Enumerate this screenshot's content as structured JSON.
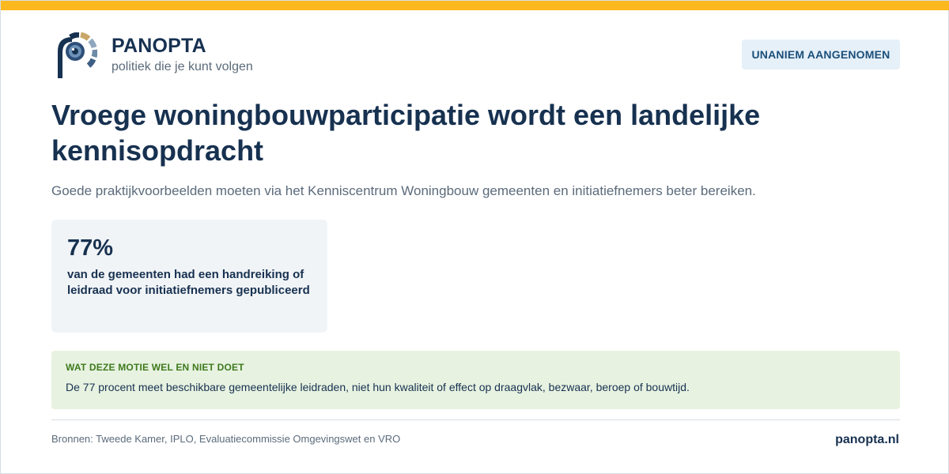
{
  "brand": {
    "name": "PANOPTA",
    "tagline": "politiek die je kunt volgen",
    "logo_icon": "eye-p-logo-icon"
  },
  "status_badge": "UNANIEM AANGENOMEN",
  "title": "Vroege woningbouwparticipatie wordt een landelijke kennisopdracht",
  "subtitle": "Goede praktijkvoorbeelden moeten via het Kenniscentrum Woningbouw gemeenten en initiatiefnemers beter bereiken.",
  "stat": {
    "value": "77%",
    "label": "van de gemeenten had een handreiking of leidraad voor initiatiefnemers gepubliceerd"
  },
  "note": {
    "heading": "WAT DEZE MOTIE WEL EN NIET DOET",
    "text": "De 77 procent meet beschikbare gemeentelijke leidraden, niet hun kwaliteit of effect op draagvlak, bezwaar, beroep of bouwtijd."
  },
  "footer": {
    "sources": "Bronnen: Tweede Kamer, IPLO, Evaluatiecommissie Omgevingswet en VRO",
    "site": "panopta.nl"
  },
  "colors": {
    "accent_bar": "#fbb91f",
    "navy": "#173150",
    "muted": "#5b6b7b",
    "badge_bg": "#e6f0f8",
    "note_bg": "#e7f2e1",
    "note_heading": "#3e7a1c"
  }
}
